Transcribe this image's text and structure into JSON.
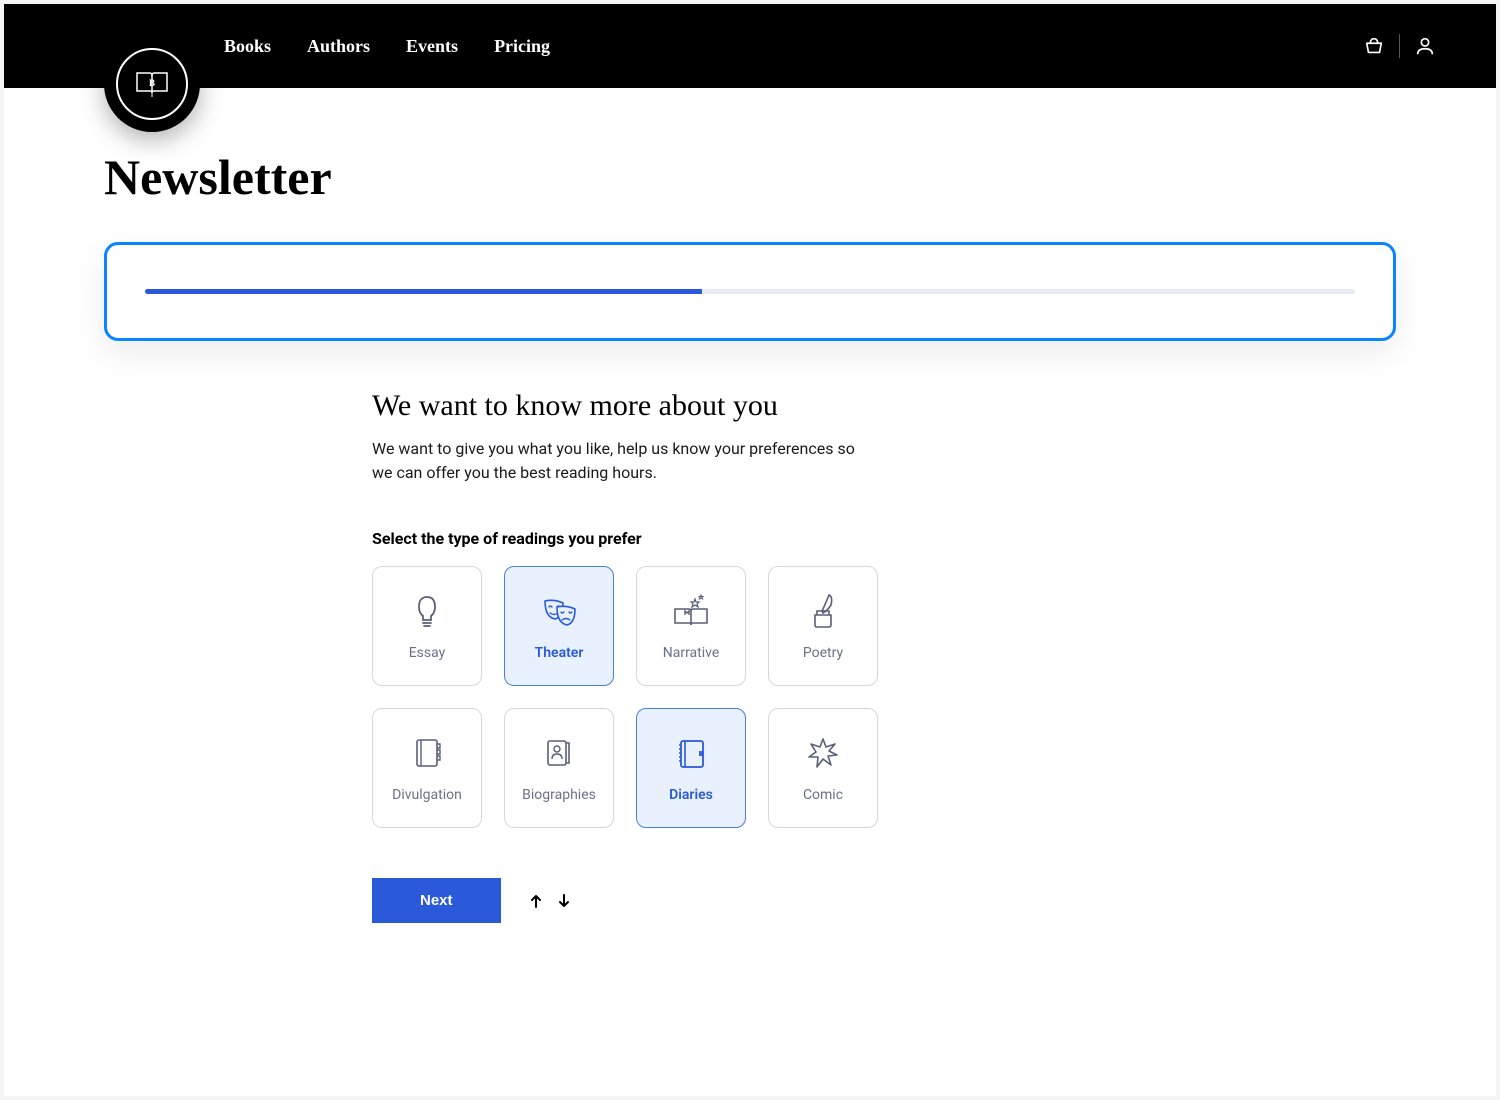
{
  "header": {
    "nav": [
      "Books",
      "Authors",
      "Events",
      "Pricing"
    ],
    "logo_letter": "B"
  },
  "page_title": "Newsletter",
  "progress": {
    "percent": 46
  },
  "form": {
    "heading": "We want to know more about you",
    "subtext": "We want to give you what you like, help us know your preferences so we can offer you the best reading hours.",
    "select_label": "Select the type of readings you prefer",
    "options": [
      {
        "id": "essay",
        "label": "Essay",
        "icon": "lightbulb-icon",
        "selected": false
      },
      {
        "id": "theater",
        "label": "Theater",
        "icon": "masks-icon",
        "selected": true
      },
      {
        "id": "narrative",
        "label": "Narrative",
        "icon": "open-book-stars-icon",
        "selected": false
      },
      {
        "id": "poetry",
        "label": "Poetry",
        "icon": "quill-ink-icon",
        "selected": false
      },
      {
        "id": "divulgation",
        "label": "Divulgation",
        "icon": "notebook-tabs-icon",
        "selected": false
      },
      {
        "id": "biographies",
        "label": "Biographies",
        "icon": "id-book-icon",
        "selected": false
      },
      {
        "id": "diaries",
        "label": "Diaries",
        "icon": "diary-icon",
        "selected": true
      },
      {
        "id": "comic",
        "label": "Comic",
        "icon": "burst-icon",
        "selected": false
      }
    ],
    "next_label": "Next"
  }
}
